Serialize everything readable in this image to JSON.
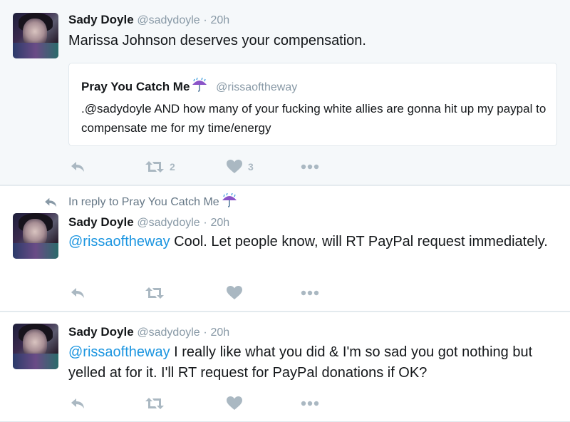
{
  "tweets": [
    {
      "author_name": "Sady Doyle",
      "author_handle": "@sadydoyle",
      "separator": "·",
      "time": "20h",
      "text": "Marissa Johnson deserves your compensation.",
      "quote": {
        "author_name": "Pray You Catch Me",
        "author_handle": "@rissaoftheway",
        "text": ".@sadydoyle AND how many of your fucking white allies are gonna hit up my paypal to compensate me for my time/energy"
      },
      "retweet_count": "2",
      "like_count": "3"
    },
    {
      "in_reply_to": "In reply to Pray You Catch Me",
      "author_name": "Sady Doyle",
      "author_handle": "@sadydoyle",
      "separator": "·",
      "time": "20h",
      "mention": "@rissaoftheway",
      "text": " Cool. Let people know, will RT PayPal request immediately."
    },
    {
      "author_name": "Sady Doyle",
      "author_handle": "@sadydoyle",
      "separator": "·",
      "time": "20h",
      "mention": "@rissaoftheway",
      "text": " I really like what you did & I'm so sad you got nothing but yelled at for it. I'll RT request for PayPal donations if OK?"
    }
  ],
  "icons": {
    "reply": "reply-icon",
    "retweet": "retweet-icon",
    "like": "heart-icon",
    "more": "more-icon",
    "emoji": "umbrella-with-rain-emoji"
  },
  "colors": {
    "link": "#1b95e0",
    "muted": "#8899a6",
    "icon": "#aab8c2",
    "highlight_bg": "#f5f8fa"
  }
}
